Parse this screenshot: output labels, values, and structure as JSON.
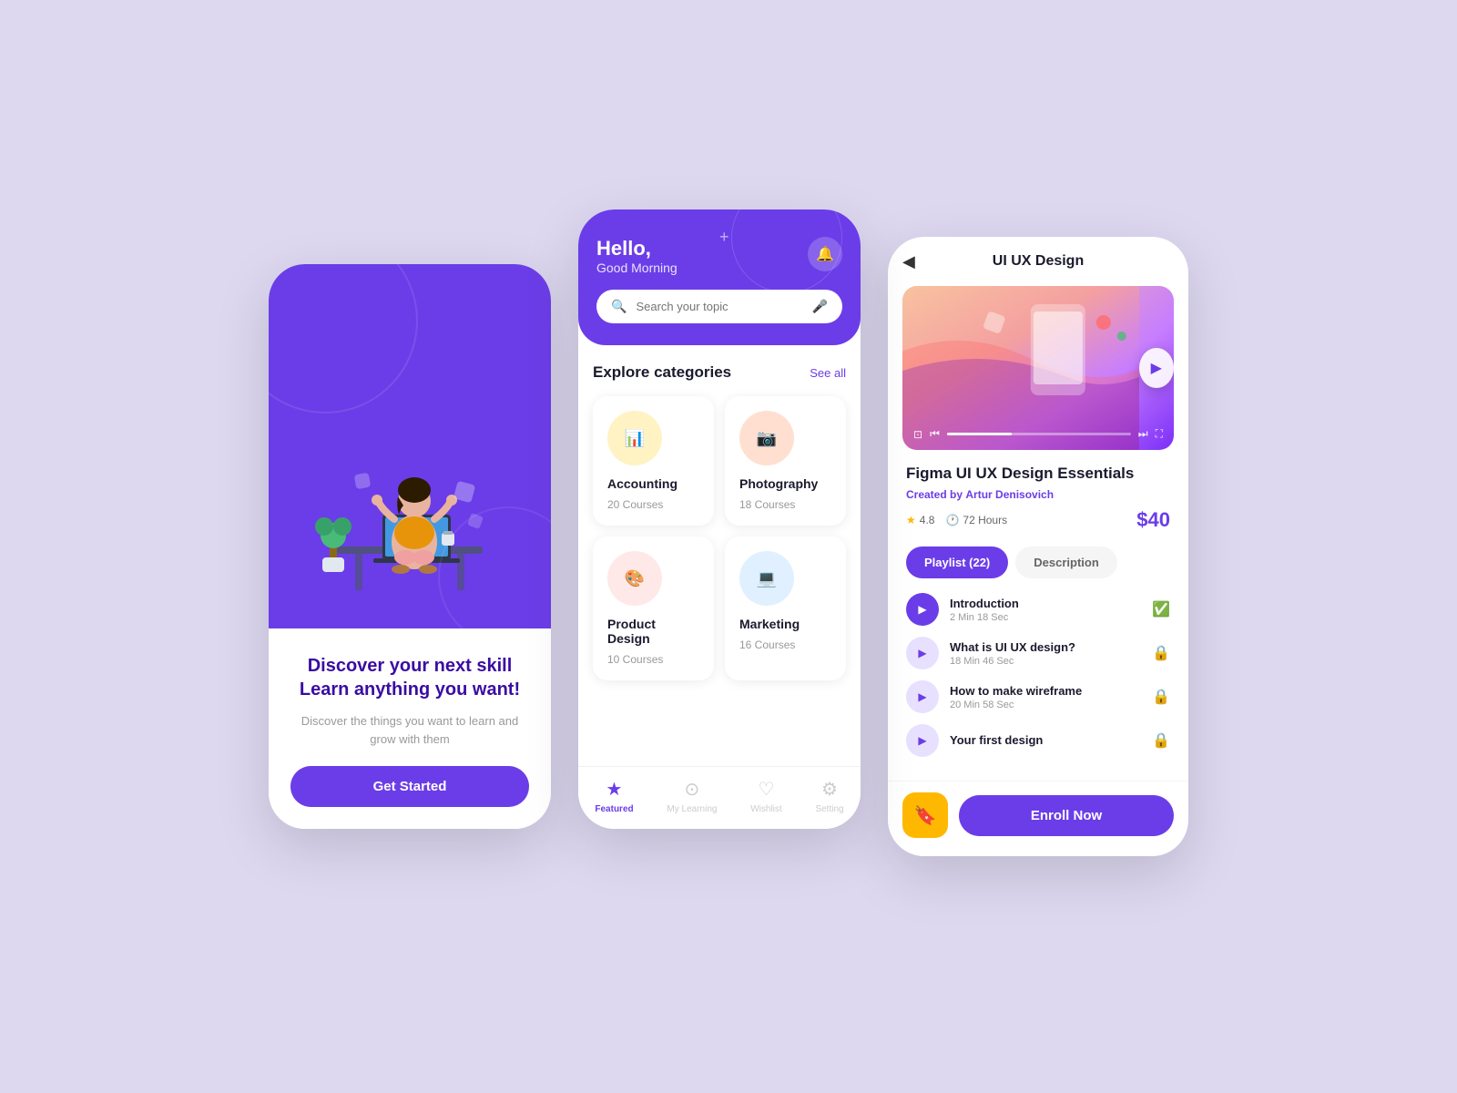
{
  "screen1": {
    "headline_line1": "Discover your next skill",
    "headline_line2": "Learn anything you want!",
    "subtext": "Discover the things you want to learn and grow with them",
    "cta_label": "Get Started"
  },
  "screen2": {
    "greeting": "Hello,",
    "subgreeting": "Good Morning",
    "search_placeholder": "Search your topic",
    "section_title": "Explore categories",
    "see_all_label": "See all",
    "categories": [
      {
        "name": "Accounting",
        "count": "20 Courses",
        "icon": "📊",
        "color_class": "category-icon-accounting"
      },
      {
        "name": "Photography",
        "count": "18 Courses",
        "icon": "📷",
        "color_class": "category-icon-photography"
      },
      {
        "name": "Product Design",
        "count": "10 Courses",
        "icon": "🎨",
        "color_class": "category-icon-product"
      },
      {
        "name": "Marketing",
        "count": "16 Courses",
        "icon": "💻",
        "color_class": "category-icon-marketing"
      }
    ],
    "nav_items": [
      {
        "label": "Featured",
        "icon": "★",
        "active": true
      },
      {
        "label": "My Learning",
        "icon": "⊙",
        "active": false
      },
      {
        "label": "Wishlist",
        "icon": "♡",
        "active": false
      },
      {
        "label": "Setting",
        "icon": "⚙",
        "active": false
      }
    ]
  },
  "screen3": {
    "back_label": "◀",
    "title": "UI UX Design",
    "course_title": "Figma UI UX Design Essentials",
    "author_label": "Created by",
    "author_name": "Artur Denisovich",
    "rating": "4.8",
    "duration": "72 Hours",
    "price": "$40",
    "tabs": [
      {
        "label": "Playlist (22)",
        "active": true
      },
      {
        "label": "Description",
        "active": false
      }
    ],
    "playlist": [
      {
        "name": "Introduction",
        "duration": "2 Min 18 Sec",
        "status": "done",
        "active": true
      },
      {
        "name": "What is UI UX design?",
        "duration": "18 Min 46 Sec",
        "status": "locked",
        "active": false
      },
      {
        "name": "How to make wireframe",
        "duration": "20 Min 58 Sec",
        "status": "locked",
        "active": false
      },
      {
        "name": "Your first design",
        "duration": "",
        "status": "locked",
        "active": false
      }
    ],
    "bookmark_icon": "🔖",
    "enroll_label": "Enroll Now"
  }
}
